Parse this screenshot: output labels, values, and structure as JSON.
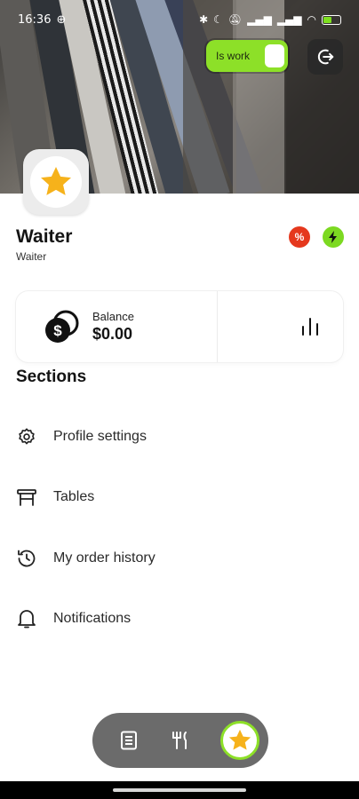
{
  "status_bar": {
    "time": "16:36",
    "battery_level": 0.45
  },
  "header": {
    "work_toggle_label": "Is work",
    "work_toggle_on": true
  },
  "profile": {
    "name": "Waiter",
    "role": "Waiter",
    "badges": [
      "discount",
      "power"
    ]
  },
  "balance": {
    "label": "Balance",
    "amount": "$0.00"
  },
  "sections": {
    "title": "Sections",
    "items": [
      {
        "label": "Profile settings",
        "icon": "gear-icon"
      },
      {
        "label": "Tables",
        "icon": "table-icon"
      },
      {
        "label": "My order history",
        "icon": "history-icon"
      },
      {
        "label": "Notifications",
        "icon": "bell-icon"
      }
    ]
  },
  "bottom_nav": {
    "items": [
      "orders-icon",
      "cutlery-icon",
      "star-icon"
    ],
    "active": "star-icon"
  },
  "colors": {
    "accent_green": "#8de028",
    "badge_red": "#e5381d",
    "star_yellow": "#f6b21b",
    "nav_bg": "#6b6b6b"
  }
}
